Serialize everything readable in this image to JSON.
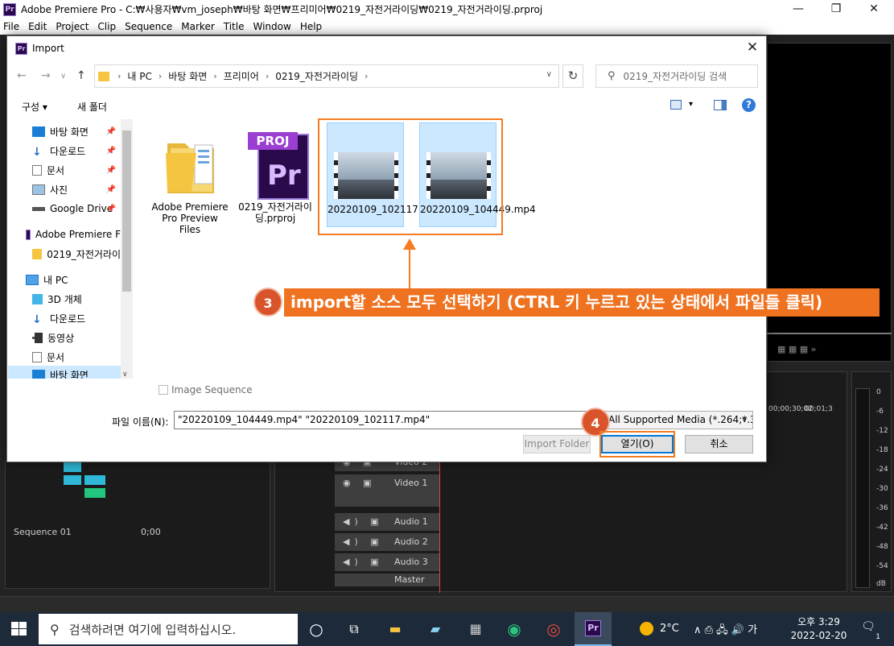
{
  "app": {
    "title": "Adobe Premiere Pro - C:₩사용자₩vm_joseph₩바탕 화면₩프리미어₩0219_자전거라이딩₩0219_자전거라이딩.prproj",
    "logo_text": "Pr",
    "controls": {
      "minimize": "—",
      "maximize": "❐",
      "close": "✕"
    },
    "menu": [
      "File",
      "Edit",
      "Project",
      "Clip",
      "Sequence",
      "Marker",
      "Title",
      "Window",
      "Help"
    ]
  },
  "premiere": {
    "sequence_name": "Sequence 01",
    "sequence_time": "0;00",
    "ruler": [
      "00;00;30;02",
      "00;01;3"
    ],
    "video_tracks": [
      "Video 2",
      "Video 1"
    ],
    "audio_tracks": [
      "Audio 1",
      "Audio 2",
      "Audio 3"
    ],
    "master_track": "Master",
    "meter_labels": [
      "0",
      "-6",
      "-12",
      "-18",
      "-24",
      "-30",
      "-36",
      "-42",
      "-48",
      "-54",
      "dB"
    ]
  },
  "dialog": {
    "title": "Import",
    "address": {
      "crumbs": [
        "내 PC",
        "바탕 화면",
        "프리미어",
        "0219_자전거라이딩"
      ]
    },
    "search_placeholder": "0219_자전거라이딩 검색",
    "toolbar": {
      "organize": "구성 ▾",
      "new_folder": "새 폴더",
      "help": "?"
    },
    "nav_items": [
      {
        "label": "바탕 화면",
        "icon": "desktop-icon",
        "pinned": true
      },
      {
        "label": "다운로드",
        "icon": "download-icon",
        "pinned": true
      },
      {
        "label": "문서",
        "icon": "document-icon",
        "pinned": true
      },
      {
        "label": "사진",
        "icon": "picture-icon",
        "pinned": true
      },
      {
        "label": "Google Drive",
        "icon": "drive-icon",
        "pinned": true
      },
      {
        "label": "Adobe Premiere F",
        "icon": "premiere-icon",
        "pinned": false
      },
      {
        "label": "0219_자전거라이",
        "icon": "folder-icon",
        "pinned": false
      },
      {
        "label": "내 PC",
        "icon": "pc-icon",
        "pinned": false
      },
      {
        "label": "3D 개체",
        "icon": "cube-icon",
        "pinned": false
      },
      {
        "label": "다운로드",
        "icon": "download-icon",
        "pinned": false
      },
      {
        "label": "동영상",
        "icon": "video-icon",
        "pinned": false
      },
      {
        "label": "문서",
        "icon": "document-icon",
        "pinned": false
      },
      {
        "label": "바탕 화면",
        "icon": "desktop-icon",
        "pinned": false
      }
    ],
    "files": [
      {
        "name": "Adobe Premiere Pro Preview Files",
        "type": "folder"
      },
      {
        "name": "0219_자전거라이딩.prproj",
        "type": "prproj",
        "badge": "PROJ"
      },
      {
        "name": "20220109_102117.mp4",
        "type": "video",
        "selected": true
      },
      {
        "name": "20220109_104449.mp4",
        "type": "video",
        "selected": true
      }
    ],
    "image_sequence_label": "Image Sequence",
    "filename_label": "파일 이름(N):",
    "filename_value": "\"20220109_104449.mp4\" \"20220109_102117.mp4\"",
    "filter_value": "All Supported Media (*.264;*.3",
    "buttons": {
      "import_folder": "Import Folder",
      "open": "열기(O)",
      "cancel": "취소"
    }
  },
  "annotations": {
    "step3_number": "3",
    "step3_text": "import할 소스 모두 선택하기 (CTRL 키 누르고 있는 상태에서 파일들 클릭)",
    "step4_number": "4",
    "accent_color": "#f47b20"
  },
  "taskbar": {
    "search_placeholder": "검색하려면 여기에 입력하십시오.",
    "weather": "2°C",
    "tray": "∧ ⎙ 🖧 🔊 가",
    "time": "오후 3:29",
    "date": "2022-02-20",
    "notification_count": "1"
  }
}
